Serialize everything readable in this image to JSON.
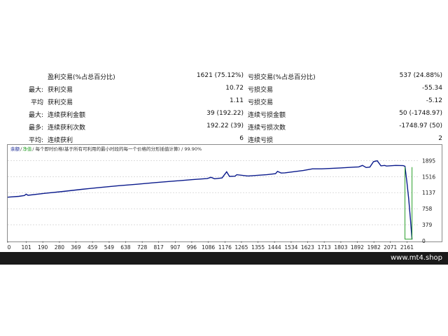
{
  "stats": {
    "rows": [
      {
        "label1": "",
        "label2": "盈利交易(%占总百分比)",
        "value1": "1621 (75.12%)",
        "label3": "亏损交易(%占总百分比)",
        "value2": "537 (24.88%)"
      },
      {
        "label1": "最大:",
        "label2": "获利交易",
        "value1": "10.72",
        "label3": "亏损交易",
        "value2": "-55.34"
      },
      {
        "label1": "平均",
        "label2": "获利交易",
        "value1": "1.11",
        "label3": "亏损交易",
        "value2": "-5.12"
      },
      {
        "label1": "最大:",
        "label2": "连续获利金额",
        "value1": "39 (192.22)",
        "label3": "连续亏损金额",
        "value2": "50 (-1748.97)"
      },
      {
        "label1": "最多:",
        "label2": "连续获利次数",
        "value1": "192.22 (39)",
        "label3": "连续亏损次数",
        "value2": "-1748.97 (50)"
      },
      {
        "label1": "平均:",
        "label2": "连续获利",
        "value1": "6",
        "label3": "连续亏损",
        "value2": "2"
      }
    ]
  },
  "chart": {
    "legend": {
      "balance": "余额",
      "separator": "/",
      "equity": "净值",
      "description": "/ 每个即时价格(基于所有可利用的最小时段的每一个价格的分形插值计算) / 99.90%"
    },
    "colors": {
      "balance": "#0a1a8c",
      "equity": "#2ca02c",
      "grid": "#c8c8c8",
      "border": "#8a8a8a"
    }
  },
  "chart_data": {
    "type": "line",
    "title": "",
    "xlabel": "",
    "ylabel": "",
    "xlim": [
      0,
      2220
    ],
    "ylim": [
      0,
      2000
    ],
    "x_ticks": [
      0,
      101,
      190,
      280,
      369,
      459,
      549,
      638,
      728,
      817,
      907,
      996,
      1086,
      1176,
      1265,
      1355,
      1444,
      1534,
      1623,
      1713,
      1803,
      1892,
      1982,
      2071,
      2161
    ],
    "y_ticks": [
      0,
      379,
      758,
      1137,
      1516,
      1895
    ],
    "series": [
      {
        "key": "balance",
        "x": [
          0,
          60,
          90,
          100,
          110,
          200,
          300,
          400,
          500,
          600,
          700,
          800,
          900,
          1000,
          1080,
          1100,
          1120,
          1160,
          1185,
          1200,
          1230,
          1240,
          1300,
          1400,
          1450,
          1460,
          1480,
          1500,
          1600,
          1650,
          1700,
          1800,
          1900,
          1920,
          1940,
          1960,
          1980,
          2000,
          2010,
          2020,
          2040,
          2050,
          2100,
          2140,
          2150,
          2160,
          2170,
          2180,
          2188
        ],
        "y": [
          1030,
          1050,
          1070,
          1100,
          1075,
          1120,
          1165,
          1215,
          1260,
          1300,
          1335,
          1375,
          1410,
          1445,
          1470,
          1500,
          1465,
          1485,
          1630,
          1520,
          1525,
          1560,
          1530,
          1560,
          1585,
          1640,
          1600,
          1605,
          1660,
          1700,
          1700,
          1720,
          1745,
          1780,
          1730,
          1740,
          1870,
          1890,
          1830,
          1770,
          1780,
          1765,
          1780,
          1775,
          1760,
          1400,
          1000,
          500,
          30
        ]
      },
      {
        "key": "equity",
        "x": [
          2150,
          2150,
          2188,
          2188
        ],
        "y": [
          1740,
          40,
          40,
          1740
        ]
      }
    ]
  },
  "footer": {
    "watermark": "www.mt4.shop"
  }
}
